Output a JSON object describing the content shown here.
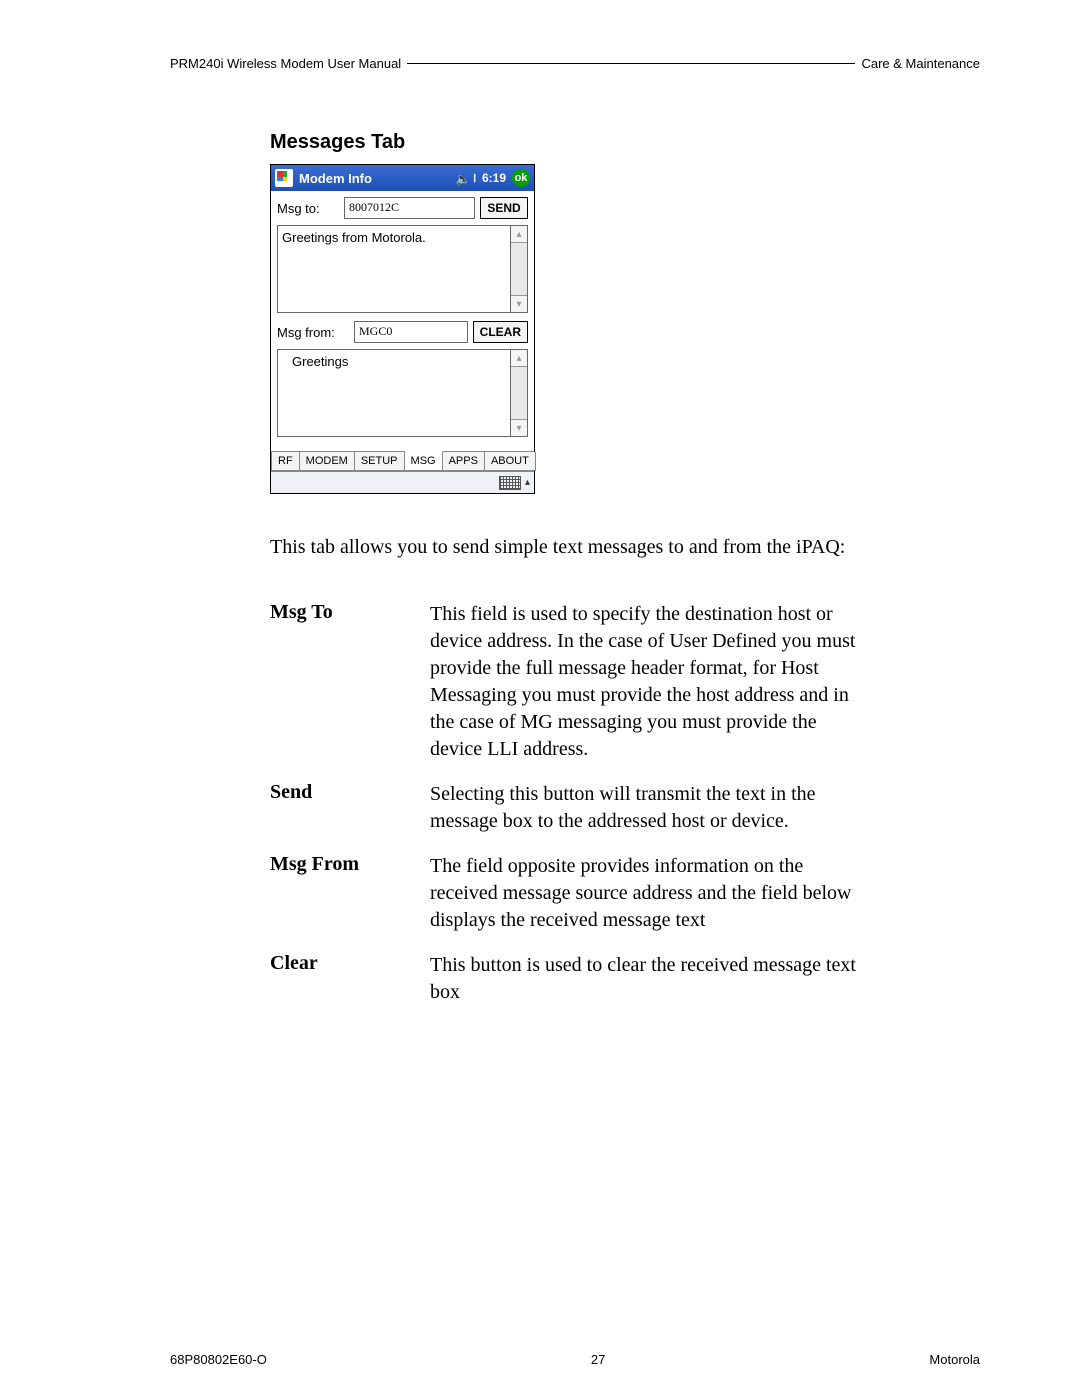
{
  "header": {
    "left": "PRM240i Wireless Modem User Manual",
    "right": "Care & Maintenance"
  },
  "section_title": "Messages Tab",
  "device": {
    "titlebar": {
      "title": "Modem Info",
      "time": "6:19",
      "ok": "ok"
    },
    "msg_to_label": "Msg to:",
    "msg_to_value": "8007012C",
    "send_button": "SEND",
    "outbox_text": "Greetings from Motorola.",
    "msg_from_label": "Msg from:",
    "msg_from_value": "MGC0",
    "clear_button": "CLEAR",
    "inbox_text": "Greetings",
    "tabs": [
      "RF",
      "MODEM",
      "SETUP",
      "MSG",
      "APPS",
      "ABOUT"
    ]
  },
  "intro": "This tab allows you to send simple text messages to and from the iPAQ:",
  "defs": [
    {
      "term": "Msg To",
      "desc": "This field is used to specify the destination host or device address. In the case of User Defined you must provide the full message header format, for Host Messaging you must provide the host address and in the case of MG messaging you must provide the device LLI address."
    },
    {
      "term": "Send",
      "desc": "Selecting this button will transmit the text in the message box to the addressed host or device."
    },
    {
      "term": "Msg From",
      "desc": "The field opposite provides information on the received message source address and the field below displays the received message text"
    },
    {
      "term": "Clear",
      "desc": "This button is used to clear the received message text box"
    }
  ],
  "footer": {
    "left": "68P80802E60-O",
    "center": "27",
    "right": "Motorola"
  }
}
